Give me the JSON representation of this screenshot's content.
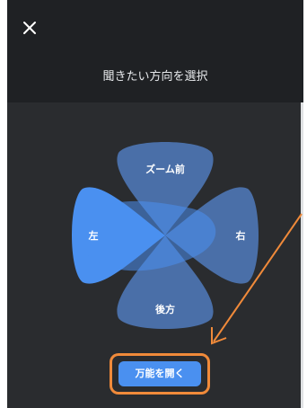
{
  "header": {
    "close_icon": "close-icon",
    "title": "聞きたい方向を選択"
  },
  "directions": {
    "front": "ズーム前",
    "left": "左",
    "right": "右",
    "back": "後方"
  },
  "action": {
    "open_label": "万能を開く"
  },
  "colors": {
    "panel_bg": "#2a2c2f",
    "panel_top_bg": "#1f2124",
    "lobe_dark": "#4a6fa8",
    "lobe_bright": "#4a90f0",
    "highlight": "#f08a3a",
    "button_bg": "#4a90f0"
  }
}
